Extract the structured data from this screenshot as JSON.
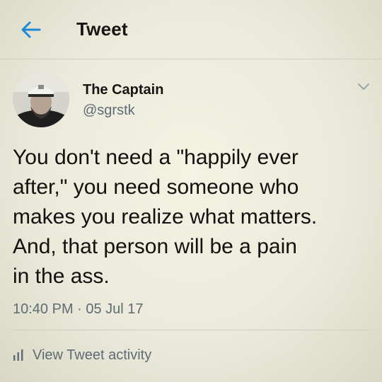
{
  "header": {
    "title": "Tweet",
    "back_icon": "arrow-left-icon",
    "accent_color": "#1b8ad9"
  },
  "tweet": {
    "author": {
      "name": "The Captain",
      "handle": "@sgrstk",
      "avatar_icon": "avatar-photo"
    },
    "text_lines": [
      "You don't need a \"happily ever",
      "after,\" you need someone who",
      "makes you realize what matters.",
      "And, that person will be a pain",
      "in the ass."
    ],
    "timestamp": "10:40 PM · 05 Jul 17",
    "more_icon": "chevron-down-icon"
  },
  "footer": {
    "activity_label": "View Tweet activity",
    "activity_icon": "bar-chart-icon"
  }
}
